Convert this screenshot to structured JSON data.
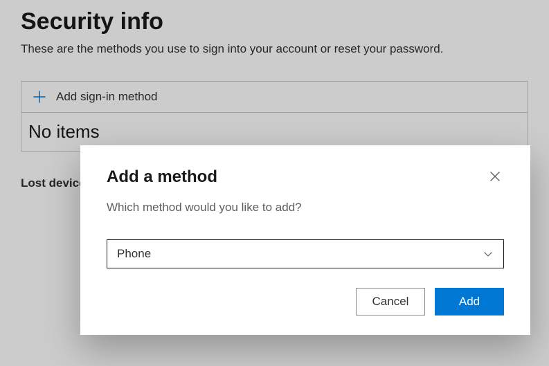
{
  "page": {
    "title": "Security info",
    "subtitle": "These are the methods you use to sign into your account or reset your password.",
    "add_method_label": "Add sign-in method",
    "no_items_label": "No items",
    "lost_device_label": "Lost device"
  },
  "dialog": {
    "title": "Add a method",
    "prompt": "Which method would you like to add?",
    "selected_method": "Phone",
    "cancel_label": "Cancel",
    "add_label": "Add"
  },
  "colors": {
    "primary": "#0078d4",
    "text": "#323130",
    "muted": "#605e5c"
  }
}
